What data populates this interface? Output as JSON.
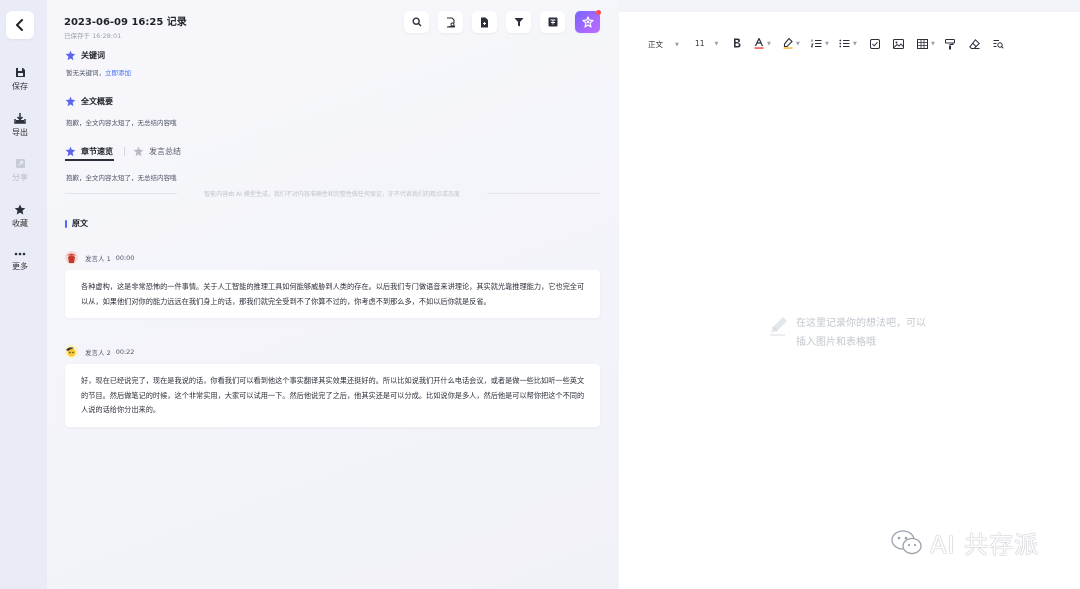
{
  "record": {
    "title": "2023-06-09 16:25 记录",
    "saved_at": "已保存于 16:28:01"
  },
  "rail": {
    "items": [
      {
        "label": "保存",
        "icon": "save-icon"
      },
      {
        "label": "导出",
        "icon": "export-icon"
      },
      {
        "label": "分享",
        "icon": "share-icon",
        "disabled": true
      },
      {
        "label": "收藏",
        "icon": "star-icon"
      },
      {
        "label": "更多",
        "icon": "more-icon"
      }
    ]
  },
  "toolbar": {
    "icons": [
      "search-icon",
      "doc-search-icon",
      "file-icon",
      "filter-icon",
      "translate-icon",
      "ai-assistant-icon"
    ]
  },
  "keywords": {
    "heading": "关键词",
    "text": "暂无关键词，",
    "link": "立即添加"
  },
  "summary": {
    "heading": "全文概要",
    "text": "抱歉，全文内容太短了，无总结内容哦"
  },
  "tabs": {
    "active": "章节速览",
    "inactive": "发言总结",
    "text": "抱歉，全文内容太短了，无总结内容哦"
  },
  "disclaimer": "智能内容由 AI 模型生成，我们不对内容准确性和完整性做任何保证，亦不代表我们的观点或态度",
  "original": {
    "heading": "原文",
    "segments": [
      {
        "speaker": "发言人 1",
        "time": "00:00",
        "text": "各种虚构，这是非常恐怖的一件事情。关于人工智能的推理工具如何能够威胁到人类的存在。以后我们专门做语音来讲理论，其实就光靠推理能力，它也完全可以从，如果他们对你的能力远远在我们身上的话，那我们就完全受到不了你算不过的，你考虑不到那么多，不如以后你就是反省。"
      },
      {
        "speaker": "发言人 2",
        "time": "00:22",
        "text": "好，现在已经说完了，现在是我说的话，你看我们可以看到他这个事实翻译其实效果还挺好的。所以比如说我们开什么电话会议，或者是做一些比如听一些英文的节目。然后做笔记的时候，这个非常实用，大家可以试用一下。然后他说完了之后，他其实还是可以分成。比如说你是多人，然后他是可以帮你把这个不同的人说的话给你分出来的。"
      }
    ]
  },
  "editor": {
    "style_select": "正文",
    "font_size": "11",
    "placeholder_line1": "在这里记录你的想法吧，可以",
    "placeholder_line2": "插入图片和表格哦"
  },
  "watermark": "AI 共存派",
  "colors": {
    "accent": "#5965ea",
    "link": "#3e6cf5",
    "ai_gradient_start": "#7a64ff",
    "ai_gradient_end": "#c06bff",
    "badge": "#ff4d4f"
  }
}
